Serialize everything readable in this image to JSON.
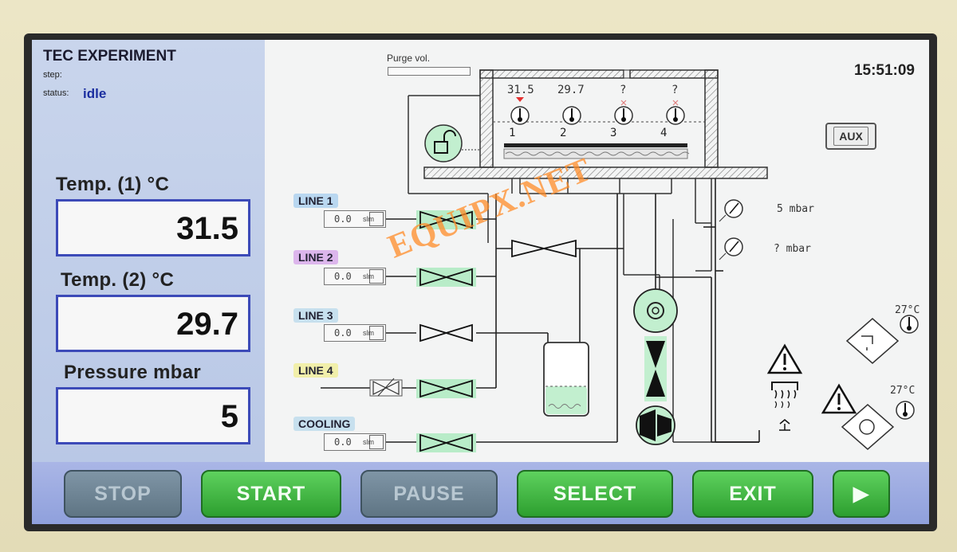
{
  "header": {
    "title": "TEC EXPERIMENT",
    "step_label": "step:",
    "status_label": "status:",
    "status_value": "idle"
  },
  "clock": "15:51:09",
  "measurements": [
    {
      "label": "Temp. (1) °C",
      "value": "31.5"
    },
    {
      "label": "Temp. (2) °C",
      "value": "29.7"
    },
    {
      "label": "Pressure mbar",
      "value": "5"
    }
  ],
  "diagram": {
    "purge_label": "Purge vol.",
    "aux_label": "AUX",
    "sensor_values": [
      "31.5",
      "29.7",
      "?",
      "?"
    ],
    "sensor_numbers": [
      "1",
      "2",
      "3",
      "4"
    ],
    "gauges": [
      {
        "value": "5",
        "unit": "mbar"
      },
      {
        "value": "?",
        "unit": "mbar"
      }
    ],
    "temps": [
      "27°C",
      "27°C"
    ],
    "lines": [
      {
        "name": "LINE 1",
        "flow": "0.0",
        "unit": "slm",
        "tag_color": "#b9d7f0"
      },
      {
        "name": "LINE 2",
        "flow": "0.0",
        "unit": "slm",
        "tag_color": "#dcb6ec"
      },
      {
        "name": "LINE 3",
        "flow": "0.0",
        "unit": "slm",
        "tag_color": "#c7e0ee"
      },
      {
        "name": "LINE 4",
        "flow": "",
        "unit": "",
        "tag_color": "#f1efaa"
      },
      {
        "name": "COOLING",
        "flow": "0.0",
        "unit": "slm",
        "tag_color": "#c7e0ee"
      }
    ],
    "watermark": "EQUIPX.NET"
  },
  "buttons": {
    "stop": "STOP",
    "start": "START",
    "pause": "PAUSE",
    "select": "SELECT",
    "exit": "EXIT",
    "next": "▶"
  },
  "colors": {
    "valve_green": "#b8ecc8",
    "button_active": "#35a838",
    "button_inactive": "#6c8291",
    "panel_blue": "#bfcdea",
    "status_blue": "#1c2fa0"
  },
  "icons": [
    "lock-icon",
    "thermometer-icon",
    "pressure-gauge-icon",
    "warning-icon",
    "heater-icon",
    "pump-icon",
    "valve-icon",
    "fan-icon"
  ]
}
